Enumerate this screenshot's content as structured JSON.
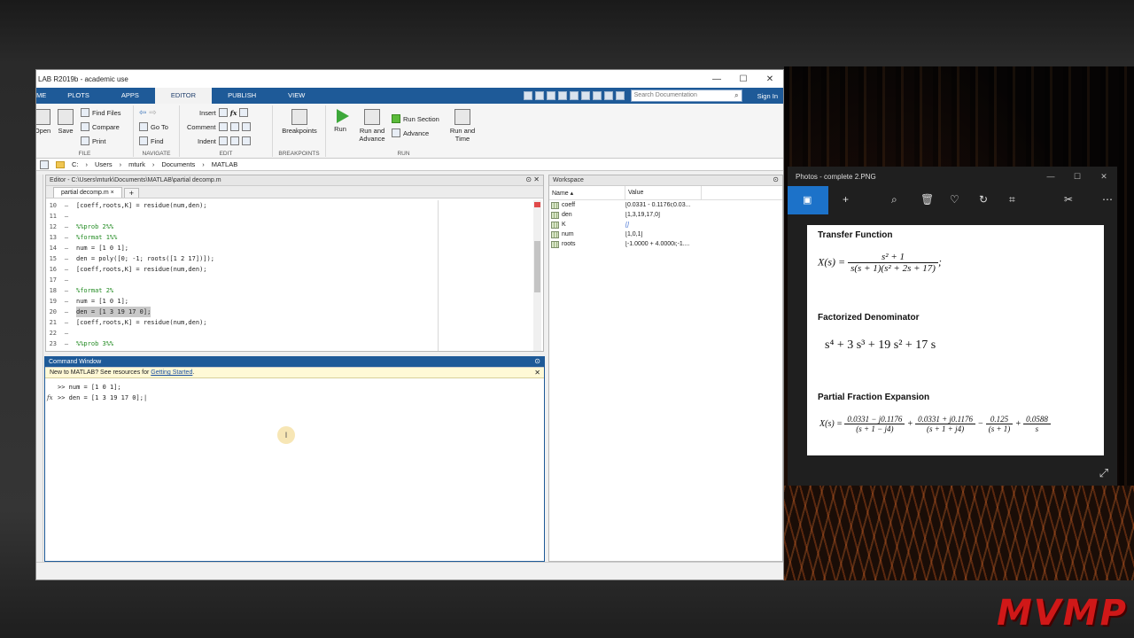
{
  "matlab": {
    "title": "LAB R2019b - academic use",
    "tabs": [
      "ME",
      "PLOTS",
      "APPS",
      "EDITOR",
      "PUBLISH",
      "VIEW"
    ],
    "active_tab": "EDITOR",
    "search_placeholder": "Search Documentation",
    "sign_in": "Sign In",
    "ribbon": {
      "file": {
        "label": "FILE",
        "open": "Open",
        "save": "Save",
        "find_files": "Find Files",
        "compare": "Compare",
        "print": "Print"
      },
      "navigate": {
        "label": "NAVIGATE",
        "go_to": "Go To",
        "find": "Find"
      },
      "edit": {
        "label": "EDIT",
        "insert": "Insert",
        "comment": "Comment",
        "indent": "Indent",
        "fx": "fx"
      },
      "breakpoints": {
        "label": "BREAKPOINTS",
        "button": "Breakpoints"
      },
      "run": {
        "label": "RUN",
        "run": "Run",
        "run_advance": "Run and Advance",
        "run_section": "Run Section",
        "advance": "Advance",
        "run_time": "Run and Time"
      }
    },
    "path": [
      "C:",
      "Users",
      "mturk",
      "Documents",
      "MATLAB"
    ],
    "editor": {
      "header": "Editor - C:\\Users\\mturk\\Documents\\MATLAB\\partial decomp.m",
      "tab": "partial decomp.m",
      "lines": [
        {
          "n": "10",
          "t": "[coeff,roots,K] = residue(num,den);",
          "c": false
        },
        {
          "n": "11",
          "t": "",
          "c": false
        },
        {
          "n": "12",
          "t": "%%prob 2%%",
          "c": true
        },
        {
          "n": "13",
          "t": "%format 1%%",
          "c": true
        },
        {
          "n": "14",
          "t": "num = [1 0 1];",
          "c": false
        },
        {
          "n": "15",
          "t": "den = poly([0; -1; roots([1 2 17])]);",
          "c": false
        },
        {
          "n": "16",
          "t": "[coeff,roots,K] = residue(num,den);",
          "c": false
        },
        {
          "n": "17",
          "t": "",
          "c": false
        },
        {
          "n": "18",
          "t": "%format 2%",
          "c": true
        },
        {
          "n": "19",
          "t": "num = [1 0 1];",
          "c": false
        },
        {
          "n": "20",
          "t": "den = [1 3 19 17 0];",
          "c": false
        },
        {
          "n": "21",
          "t": "[coeff,roots,K] = residue(num,den);",
          "c": false
        },
        {
          "n": "22",
          "t": "",
          "c": false
        },
        {
          "n": "23",
          "t": "%%prob 3%%",
          "c": true
        }
      ]
    },
    "command": {
      "header": "Command Window",
      "notice": "New to MATLAB? See resources for ",
      "notice_link": "Getting Started",
      "lines": [
        ">> num = [1 0 1];",
        ">> den = [1 3 19 17 0];"
      ]
    },
    "workspace": {
      "header": "Workspace",
      "col_name": "Name",
      "col_value": "Value",
      "rows": [
        {
          "name": "coeff",
          "value": "[0.0331 - 0.1176i;0.03..."
        },
        {
          "name": "den",
          "value": "[1,3,19,17,0]"
        },
        {
          "name": "K",
          "value": "[]"
        },
        {
          "name": "num",
          "value": "[1,0,1]"
        },
        {
          "name": "roots",
          "value": "[-1.0000 + 4.0000i;-1...."
        }
      ]
    }
  },
  "photos": {
    "title": "Photos - complete 2.PNG",
    "h_transfer": "Transfer Function",
    "h_factor": "Factorized Denominator",
    "h_partial": "Partial Fraction Expansion",
    "tf_lhs": "X(s) =",
    "tf_num": "s² + 1",
    "tf_den": "s(s + 1)(s² + 2s + 17)",
    "factor_eq": "s⁴ + 3 s³ + 19 s² + 17 s",
    "pf_lhs": "X(s) =",
    "pf_t1_num": "0.0331 − j0.1176",
    "pf_t1_den": "(s + 1 − j4)",
    "pf_t2_num": "0.0331 + j0.1176",
    "pf_t2_den": "(s + 1 + j4)",
    "pf_t3_num": "0.125",
    "pf_t3_den": "(s + 1)",
    "pf_t4_num": "0.0588",
    "pf_t4_den": "s"
  },
  "logo": "MVMP"
}
